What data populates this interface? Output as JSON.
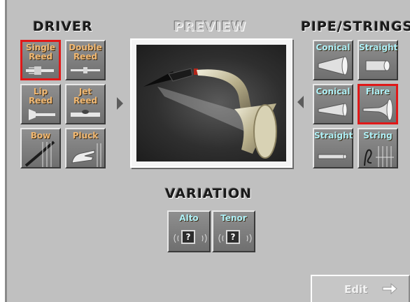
{
  "headings": {
    "driver": "DRIVER",
    "preview": "PREVIEW",
    "pipe_strings": "PIPE/STRINGS",
    "variation": "VARIATION"
  },
  "driver_buttons": [
    {
      "label": "Single\nReed",
      "selected": true
    },
    {
      "label": "Double\nReed",
      "selected": false
    },
    {
      "label": "Lip\nReed",
      "selected": false
    },
    {
      "label": "Jet\nReed",
      "selected": false
    },
    {
      "label": "Bow",
      "selected": false
    },
    {
      "label": "Pluck",
      "selected": false
    }
  ],
  "pipe_buttons": [
    {
      "label": "Conical",
      "selected": false
    },
    {
      "label": "Straight",
      "selected": false
    },
    {
      "label": "Conical",
      "selected": false
    },
    {
      "label": "Flare",
      "selected": true
    },
    {
      "label": "Straight",
      "selected": false
    },
    {
      "label": "String",
      "selected": false
    }
  ],
  "variation_buttons": [
    {
      "label": "Alto",
      "icon_text": "?"
    },
    {
      "label": "Tenor",
      "icon_text": "?"
    }
  ],
  "edit_button": {
    "label": "Edit",
    "enabled": false
  },
  "colors": {
    "selected_outline": "#e01818",
    "driver_label": "#f0b872",
    "pipe_label": "#aef0f7",
    "background": "#c0c0c0"
  },
  "preview": {
    "icon": "saxophone-preview-image"
  }
}
